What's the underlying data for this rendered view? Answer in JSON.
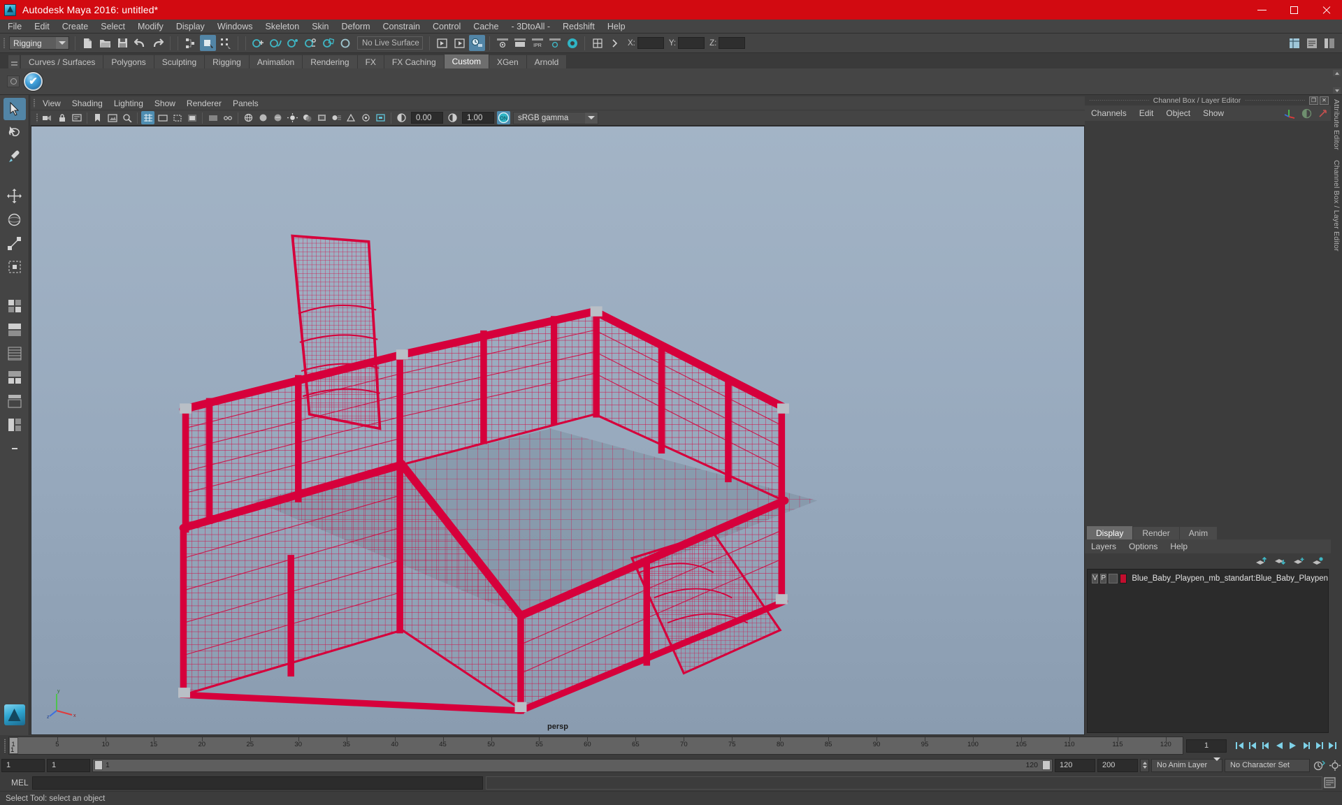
{
  "window": {
    "title": "Autodesk Maya 2016: untitled*",
    "app_icon": "maya-logo-icon",
    "minimize": "–",
    "maximize": "□",
    "close": "✕"
  },
  "menubar": {
    "items": [
      {
        "label": "File"
      },
      {
        "label": "Edit"
      },
      {
        "label": "Create"
      },
      {
        "label": "Select"
      },
      {
        "label": "Modify"
      },
      {
        "label": "Display"
      },
      {
        "label": "Windows"
      },
      {
        "label": "Skeleton"
      },
      {
        "label": "Skin"
      },
      {
        "label": "Deform"
      },
      {
        "label": "Constrain"
      },
      {
        "label": "Control"
      },
      {
        "label": "Cache"
      },
      {
        "label": "- 3DtoAll -"
      },
      {
        "label": "Redshift"
      },
      {
        "label": "Help"
      }
    ]
  },
  "toolbar": {
    "menuset_value": "Rigging",
    "live_surface": "No Live Surface",
    "coord_x_label": "X:",
    "coord_y_label": "Y:",
    "coord_z_label": "Z:",
    "coord_x_value": "",
    "coord_y_value": "",
    "coord_z_value": "",
    "icons": [
      "new-scene-icon",
      "open-scene-icon",
      "save-scene-icon",
      "undo-icon",
      "redo-icon",
      "select-by-hierarchy-icon",
      "select-by-object-icon",
      "select-by-component-icon",
      "snap-to-grid-icon",
      "snap-to-curve-icon",
      "snap-to-point-icon",
      "snap-to-projected-center-icon",
      "snap-to-view-plane-icon",
      "make-live-icon",
      "render-current-frame-icon",
      "ipr-render-icon",
      "render-settings-icon",
      "hypershade-icon",
      "render-view-icon",
      "render-sequence-icon",
      "rendering-flags-icon",
      "hypergraph-icon"
    ]
  },
  "shelf": {
    "tabs": [
      {
        "label": "Curves / Surfaces",
        "selected": false
      },
      {
        "label": "Polygons",
        "selected": false
      },
      {
        "label": "Sculpting",
        "selected": false
      },
      {
        "label": "Rigging",
        "selected": false
      },
      {
        "label": "Animation",
        "selected": false
      },
      {
        "label": "Rendering",
        "selected": false
      },
      {
        "label": "FX",
        "selected": false
      },
      {
        "label": "FX Caching",
        "selected": false
      },
      {
        "label": "Custom",
        "selected": true
      },
      {
        "label": "XGen",
        "selected": false
      },
      {
        "label": "Arnold",
        "selected": false
      }
    ],
    "buttons": [
      {
        "name": "shelf-item-maya-check",
        "icon": "blue-check-sphere-icon"
      }
    ]
  },
  "toolbox": {
    "items": [
      {
        "name": "select-tool",
        "icon": "arrow-cursor-icon",
        "selected": true
      },
      {
        "name": "lasso-select-tool",
        "icon": "lasso-icon",
        "selected": false
      },
      {
        "name": "paint-select-tool",
        "icon": "paint-brush-icon",
        "selected": false
      },
      {
        "name": "move-tool",
        "icon": "move-arrows-icon",
        "selected": false
      },
      {
        "name": "rotate-tool",
        "icon": "rotate-ring-icon",
        "selected": false
      },
      {
        "name": "scale-tool",
        "icon": "scale-box-icon",
        "selected": false
      },
      {
        "name": "last-tool-used",
        "icon": "last-tool-icon",
        "selected": false
      },
      {
        "name": "single-perspective-view",
        "icon": "single-pane-icon",
        "selected": false
      },
      {
        "name": "four-view-layout",
        "icon": "four-pane-icon",
        "selected": false
      },
      {
        "name": "persp-outliner-layout",
        "icon": "persp-outliner-icon",
        "selected": false
      },
      {
        "name": "persp-graph-layout",
        "icon": "persp-graph-icon",
        "selected": false
      },
      {
        "name": "hypershade-layout",
        "icon": "hypershade-layout-icon",
        "selected": false
      },
      {
        "name": "persp-hypergraph-layout",
        "icon": "persp-hypergraph-icon",
        "selected": false
      },
      {
        "name": "minimize-layout",
        "icon": "minimize-dash-icon",
        "selected": false
      }
    ]
  },
  "viewport": {
    "menus": [
      {
        "label": "View"
      },
      {
        "label": "Shading"
      },
      {
        "label": "Lighting"
      },
      {
        "label": "Show"
      },
      {
        "label": "Renderer"
      },
      {
        "label": "Panels"
      }
    ],
    "camera_label": "persp",
    "exposure_value": "0.00",
    "gamma_value": "1.00",
    "color_management_toggle": "ON",
    "color_profile": "sRGB gamma",
    "toolbar_icons": [
      "select-camera-icon",
      "lock-camera-icon",
      "camera-attributes-icon",
      "bookmark-icon",
      "image-plane-icon",
      "two-d-pan-zoom-icon",
      "grid-toggle-icon",
      "film-gate-icon",
      "resolution-gate-icon",
      "gate-mask-icon",
      "xray-toggle-icon",
      "xray-joints-icon",
      "wireframe-icon",
      "smooth-shade-all-icon",
      "smooth-shade-textured-icon",
      "use-all-lights-icon",
      "shadows-icon",
      "screen-space-ao-icon",
      "motion-blur-icon",
      "multisample-aa-icon",
      "depth-of-field-icon",
      "isolate-select-icon",
      "exposure-icon",
      "gamma-icon",
      "color-management-icon"
    ],
    "object_color": "#d6003b",
    "background_top": "#9fb1c4",
    "background_bottom": "#8b9db0",
    "axis_labels": {
      "x": "x",
      "y": "y",
      "z": "z"
    }
  },
  "channel_box": {
    "panel_title": "Channel Box / Layer Editor",
    "menus": [
      {
        "label": "Channels"
      },
      {
        "label": "Edit"
      },
      {
        "label": "Object"
      },
      {
        "label": "Show"
      }
    ],
    "icons": [
      "channel-box-icon",
      "attribute-editor-icon",
      "layer-editor-icon"
    ],
    "float_button": "❐",
    "close_button": "✕"
  },
  "layer_editor": {
    "tabs": [
      {
        "label": "Display",
        "selected": true
      },
      {
        "label": "Render",
        "selected": false
      },
      {
        "label": "Anim",
        "selected": false
      }
    ],
    "menus": [
      {
        "label": "Layers"
      },
      {
        "label": "Options"
      },
      {
        "label": "Help"
      }
    ],
    "tool_icons": [
      "move-layer-up-icon",
      "move-layer-down-icon",
      "new-layer-icon",
      "new-layer-from-selected-icon"
    ],
    "layers": [
      {
        "visibility": "V",
        "playback": "P",
        "display_type": "",
        "color": "#c20e2e",
        "name": "Blue_Baby_Playpen_mb_standart:Blue_Baby_Playpen"
      }
    ]
  },
  "dock_labels": {
    "attribute_editor": "Attribute Editor",
    "channel_box_layer_editor": "Channel Box / Layer Editor"
  },
  "timeline": {
    "start_visible": "1",
    "ticks": [
      {
        "value": "5"
      },
      {
        "value": "10"
      },
      {
        "value": "15"
      },
      {
        "value": "20"
      },
      {
        "value": "25"
      },
      {
        "value": "30"
      },
      {
        "value": "35"
      },
      {
        "value": "40"
      },
      {
        "value": "45"
      },
      {
        "value": "50"
      },
      {
        "value": "55"
      },
      {
        "value": "60"
      },
      {
        "value": "65"
      },
      {
        "value": "70"
      },
      {
        "value": "75"
      },
      {
        "value": "80"
      },
      {
        "value": "85"
      },
      {
        "value": "90"
      },
      {
        "value": "95"
      },
      {
        "value": "100"
      },
      {
        "value": "105"
      },
      {
        "value": "110"
      },
      {
        "value": "115"
      },
      {
        "value": "120"
      }
    ],
    "current_frame": "1",
    "current_frame_field": "1",
    "playback_icons": [
      "go-to-start-icon",
      "step-back-key-icon",
      "step-back-frame-icon",
      "play-backwards-icon",
      "play-forwards-icon",
      "step-forward-frame-icon",
      "step-forward-key-icon",
      "go-to-end-icon"
    ],
    "range": {
      "anim_start": "1",
      "playback_start": "1",
      "slider_label": "1",
      "slider_end_label": "120",
      "playback_end": "120",
      "anim_end": "200"
    },
    "anim_layer": "No Anim Layer",
    "character_set": "No Character Set",
    "auto_key_icon": "auto-keyframe-icon",
    "anim_prefs_icon": "animation-preferences-icon"
  },
  "command_line": {
    "language_label": "MEL",
    "input_value": "",
    "output_value": "",
    "script_editor_icon": "script-editor-icon"
  },
  "statusbar": {
    "message": "Select Tool: select an object"
  },
  "colors": {
    "title_red": "#d20a11",
    "accent_blue": "#5285a6",
    "panel_bg": "#3c3c3c",
    "toolbar_bg": "#444444",
    "wireframe_red": "#d6003b"
  }
}
